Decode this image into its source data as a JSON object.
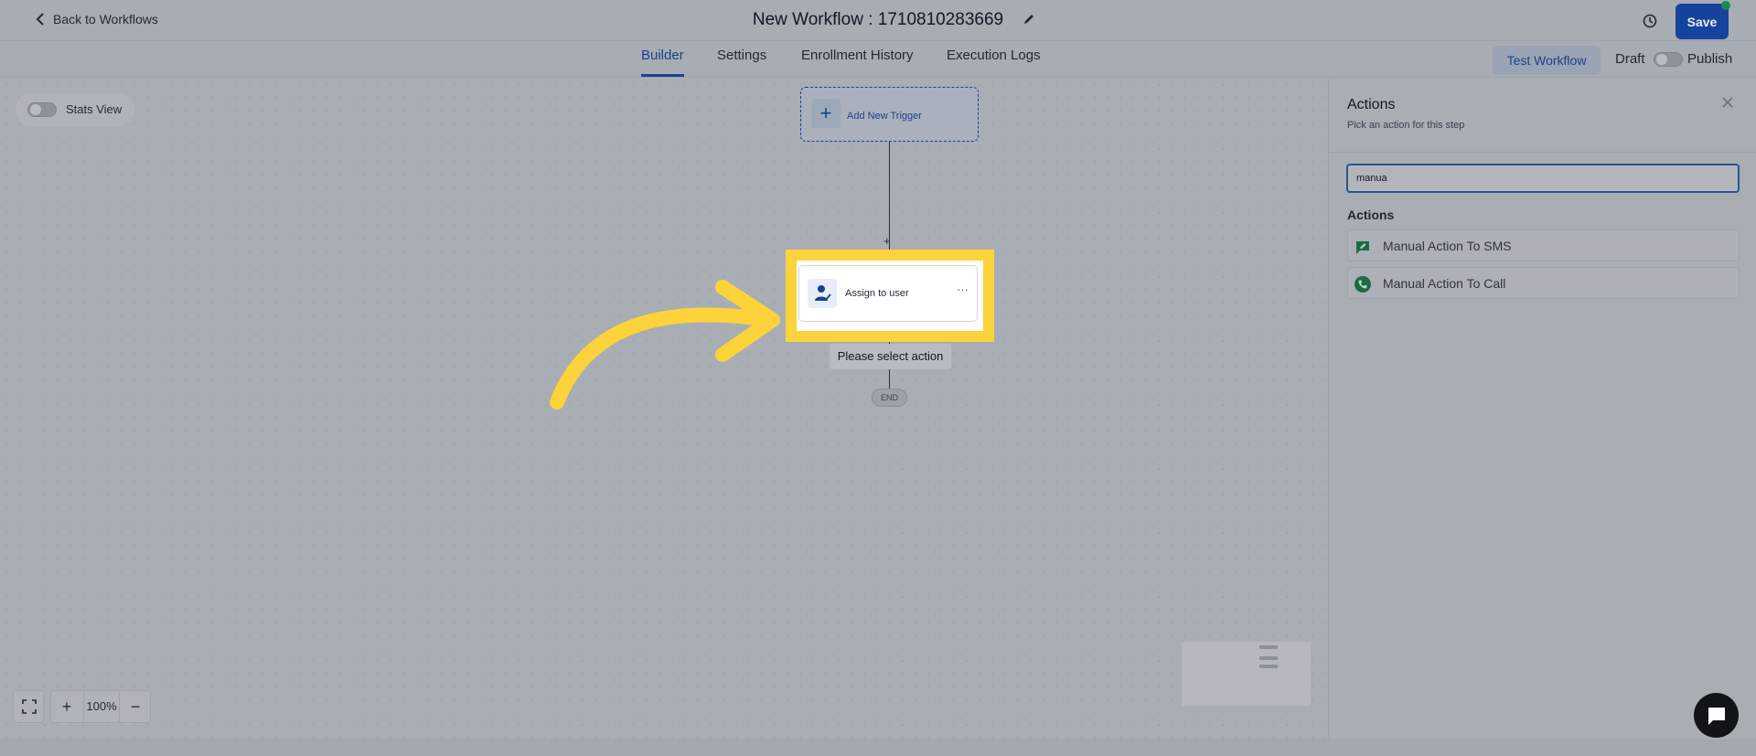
{
  "header": {
    "back_label": "Back to Workflows",
    "title": "New Workflow : 1710810283669",
    "save_label": "Save"
  },
  "tabs": [
    {
      "label": "Builder",
      "active": true
    },
    {
      "label": "Settings",
      "active": false
    },
    {
      "label": "Enrollment History",
      "active": false
    },
    {
      "label": "Execution Logs",
      "active": false
    }
  ],
  "toolbar": {
    "test_label": "Test Workflow",
    "draft_label": "Draft",
    "publish_label": "Publish"
  },
  "canvas": {
    "stats_label": "Stats View",
    "trigger_label": "Add New Trigger",
    "add_symbol": "+",
    "action_label": "Assign to user",
    "action_menu": "···",
    "select_tip": "Please select action",
    "end_label": "END",
    "zoom": "100%",
    "zoom_in": "+",
    "zoom_out": "−"
  },
  "panel": {
    "title": "Actions",
    "subtitle": "Pick an action for this step",
    "search_value": "manua",
    "section_heading": "Actions",
    "results": [
      {
        "label": "Manual Action To SMS",
        "icon": "sms-icon"
      },
      {
        "label": "Manual Action To Call",
        "icon": "phone-icon"
      }
    ]
  },
  "colors": {
    "accent": "#17438f",
    "highlight": "#fcd33b",
    "icon_green": "#1c6b44"
  }
}
